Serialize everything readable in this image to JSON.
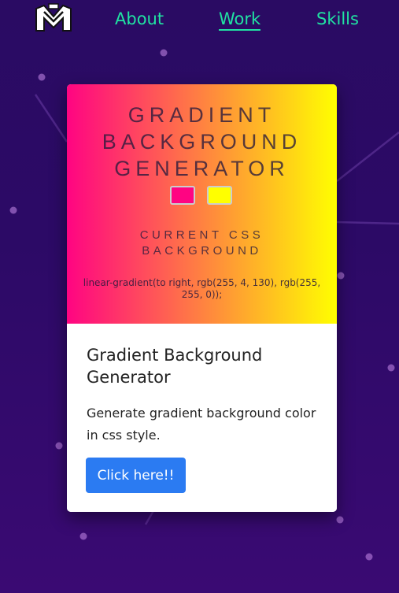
{
  "nav": {
    "links": [
      {
        "label": "About"
      },
      {
        "label": "Work"
      },
      {
        "label": "Skills"
      }
    ],
    "active": "Work"
  },
  "card": {
    "preview": {
      "title": "GRADIENT BACKGROUND GENERATOR",
      "color1": "#ff0482",
      "color2": "#ffff00",
      "current_label": "CURRENT CSS BACKGROUND",
      "css_output": "linear-gradient(to right, rgb(255, 4, 130), rgb(255, 255, 0));"
    },
    "title": "Gradient Background Generator",
    "description": "Generate gradient background color in css style.",
    "button_label": "Click here!!"
  },
  "colors": {
    "nav_link": "#20e3a2",
    "button": "#2b7bf2",
    "background": "#2c0a66"
  }
}
